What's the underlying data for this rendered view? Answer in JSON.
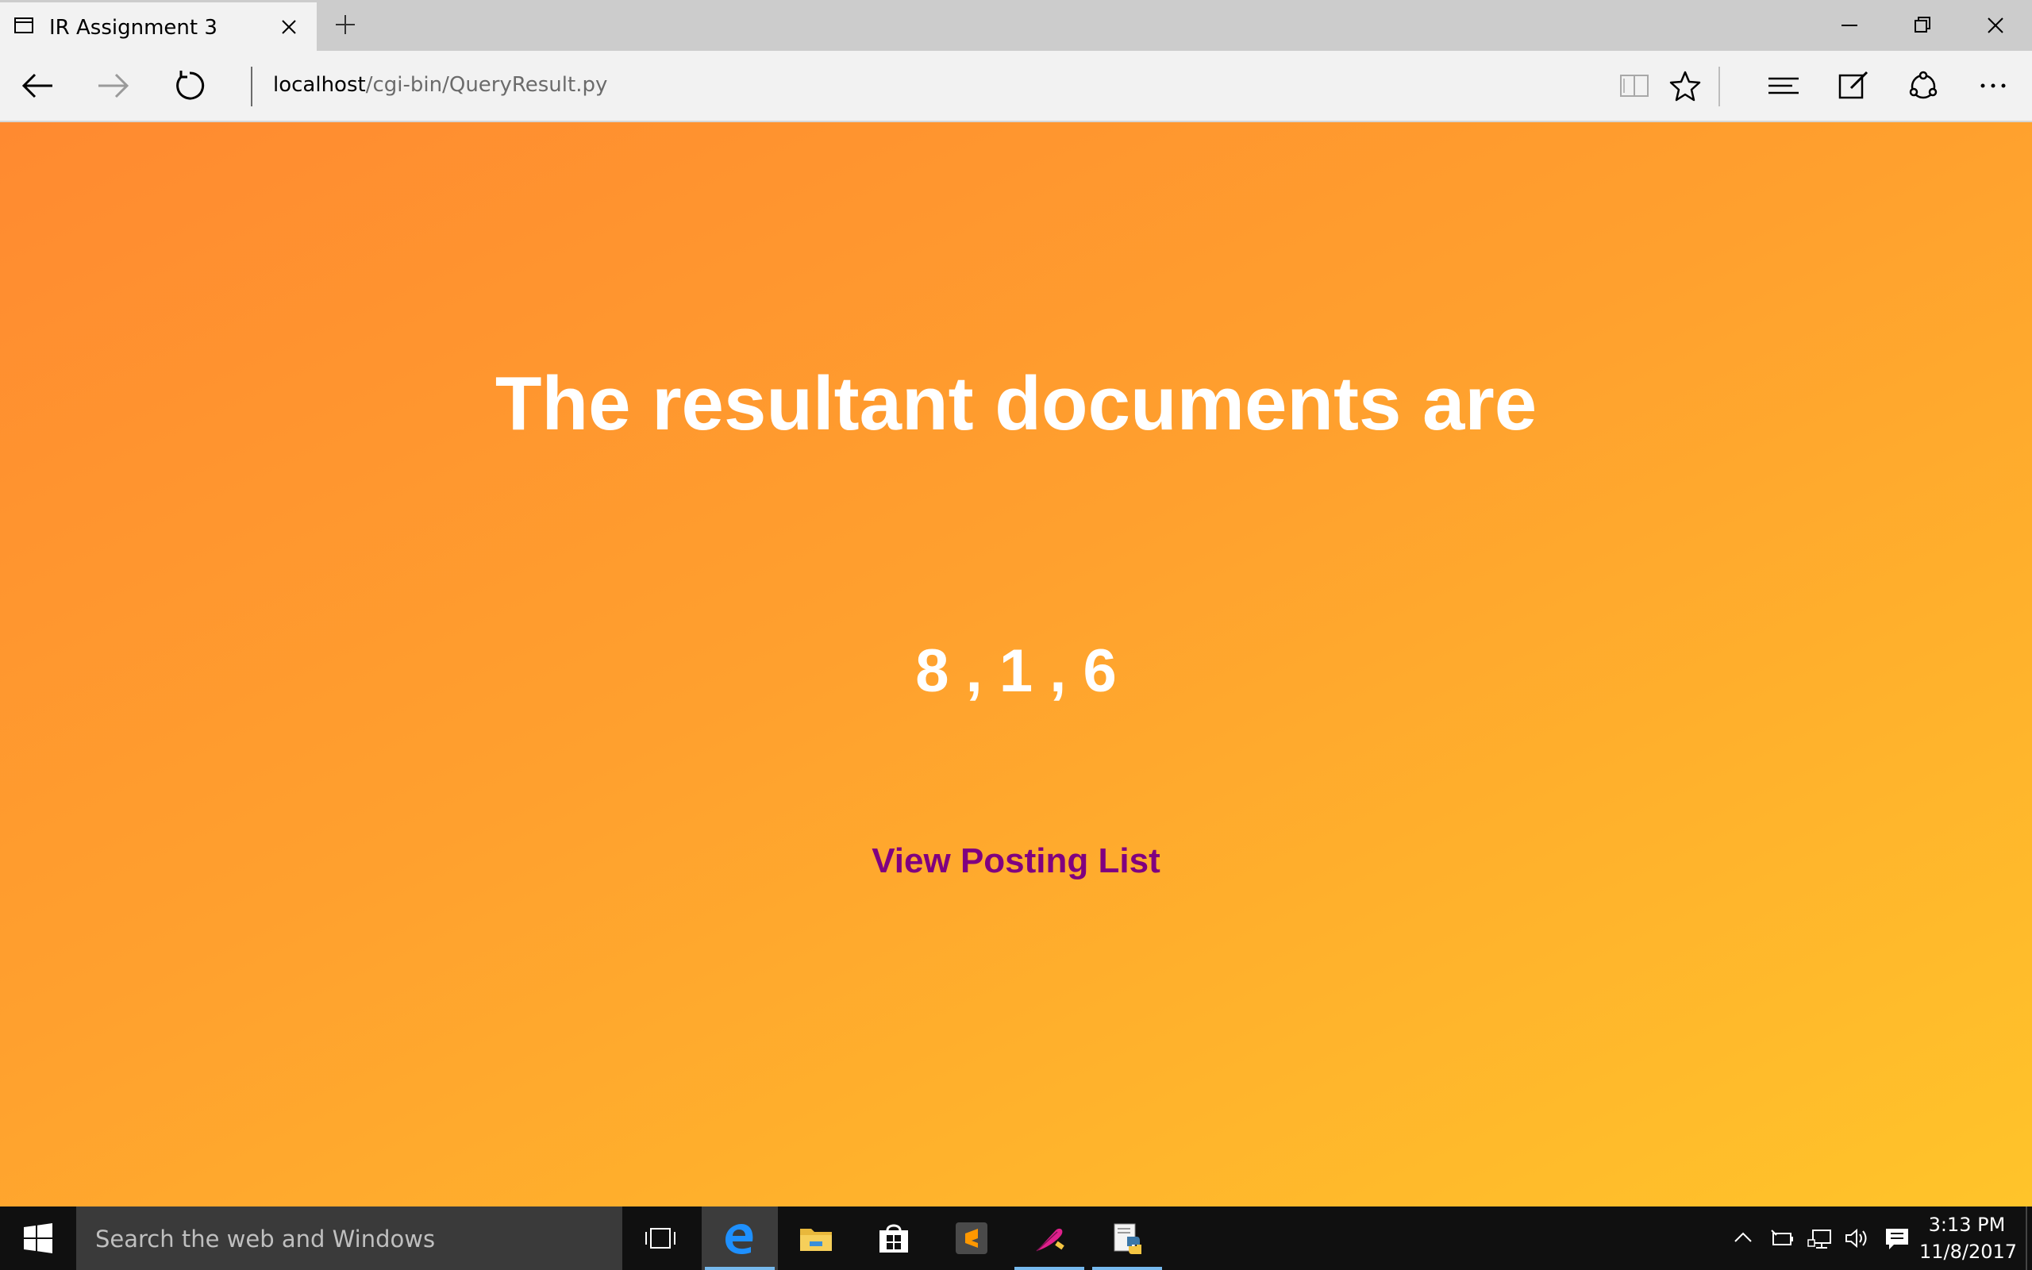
{
  "browser": {
    "tab": {
      "title": "IR Assignment 3"
    },
    "address": {
      "host": "localhost",
      "path": "/cgi-bin/QueryResult.py"
    }
  },
  "page": {
    "heading": "The resultant documents are",
    "result_documents": "8 , 1 , 6",
    "link_label": "View Posting List",
    "colors": {
      "background_start": "#ff8a30",
      "background_end": "#ffc42a",
      "text": "#ffffff",
      "link": "#800080"
    }
  },
  "taskbar": {
    "search_placeholder": "Search the web and Windows",
    "apps": [
      "task-view-icon",
      "edge-icon",
      "file-explorer-icon",
      "store-icon",
      "sublime-text-icon",
      "feather-icon",
      "python-idle-icon"
    ],
    "clock": {
      "time": "3:13 PM",
      "date": "11/8/2017"
    }
  }
}
